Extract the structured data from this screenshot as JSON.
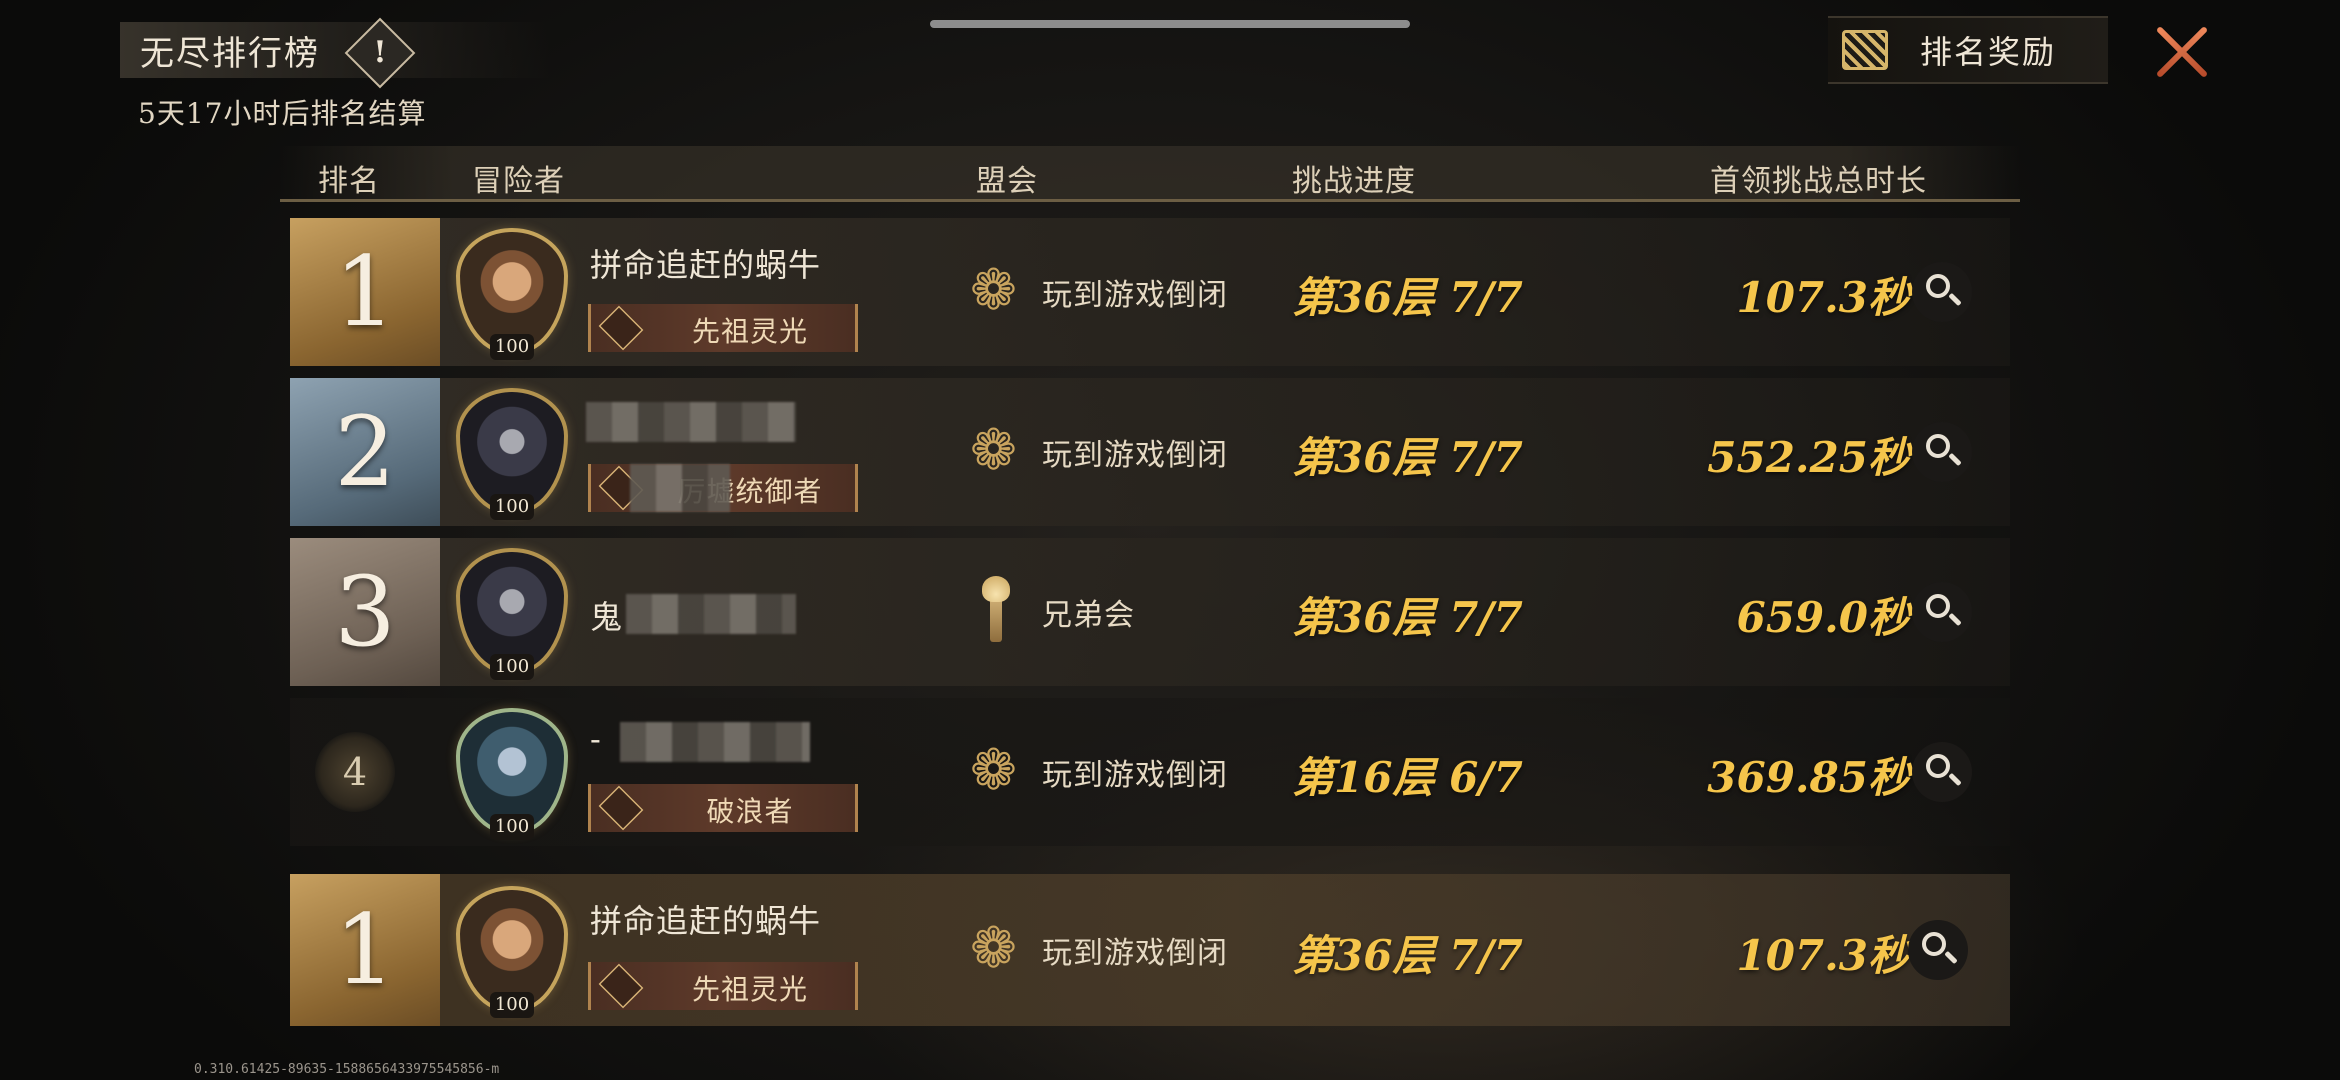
{
  "header": {
    "title": "无尽排行榜",
    "info_icon": "!",
    "countdown": "5天17小时后排名结算",
    "reward_button_label": "排名奖励"
  },
  "columns": {
    "rank": "排名",
    "adventurer": "冒险者",
    "guild": "盟会",
    "progress": "挑战进度",
    "duration": "首领挑战总时长"
  },
  "rows": [
    {
      "rank": "1",
      "rank_style": "gold",
      "avatar_level": "100",
      "avatar_icon": "hero-portrait-icon",
      "name": "拼命追赶的蜗牛",
      "title": "先祖灵光",
      "guild_icon": "dragon-guild-icon",
      "guild": "玩到游戏倒闭",
      "progress": "第36层 7/7",
      "duration": "107.3秒"
    },
    {
      "rank": "2",
      "rank_style": "silver",
      "avatar_level": "100",
      "avatar_icon": "hero-portrait-icon",
      "name": "",
      "title": "厉墟统御者",
      "guild_icon": "dragon-guild-icon",
      "guild": "玩到游戏倒闭",
      "progress": "第36层 7/7",
      "duration": "552.25秒"
    },
    {
      "rank": "3",
      "rank_style": "bronze",
      "avatar_level": "100",
      "avatar_icon": "hero-portrait-icon",
      "name": "鬼",
      "title": "",
      "guild_icon": "torch-guild-icon",
      "guild": "兄弟会",
      "progress": "第36层 7/7",
      "duration": "659.0秒"
    },
    {
      "rank": "4",
      "rank_style": "plain",
      "avatar_level": "100",
      "avatar_icon": "hero-portrait-icon",
      "name": "-",
      "title": "破浪者",
      "guild_icon": "dragon-guild-icon",
      "guild": "玩到游戏倒闭",
      "progress": "第16层 6/7",
      "duration": "369.85秒"
    }
  ],
  "my_row": {
    "rank": "1",
    "avatar_level": "100",
    "name": "拼命追赶的蜗牛",
    "title": "先祖灵光",
    "guild": "玩到游戏倒闭",
    "progress": "第36层 7/7",
    "duration": "107.3秒"
  },
  "build_info": "0.310.61425-89635-1588656433975545856-m",
  "colors": {
    "accent_gold": "#f5c54b",
    "rank1": "#c7a060",
    "rank2": "#8ea2b1",
    "rank3": "#9b8c7d",
    "close": "#e0693c"
  }
}
